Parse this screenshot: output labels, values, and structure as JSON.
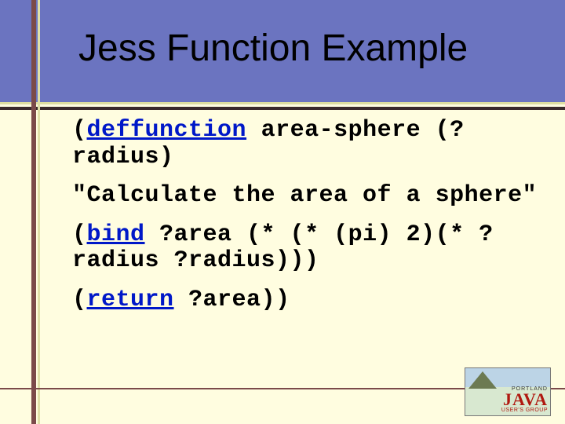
{
  "title": "Jess Function Example",
  "code": {
    "line1_kw": "deffunction",
    "line1_rest": " area-sphere (?radius)",
    "line2": "\"Calculate the area of a sphere\"",
    "line3_kw": "bind",
    "line3_rest": " ?area (* (* (pi) 2)(* ?radius ?radius)))",
    "line4_kw": "return",
    "line4_rest": " ?area))"
  },
  "logo": {
    "small": "PORTLAND",
    "big": "JAVA",
    "sub": "USER'S GROUP"
  }
}
